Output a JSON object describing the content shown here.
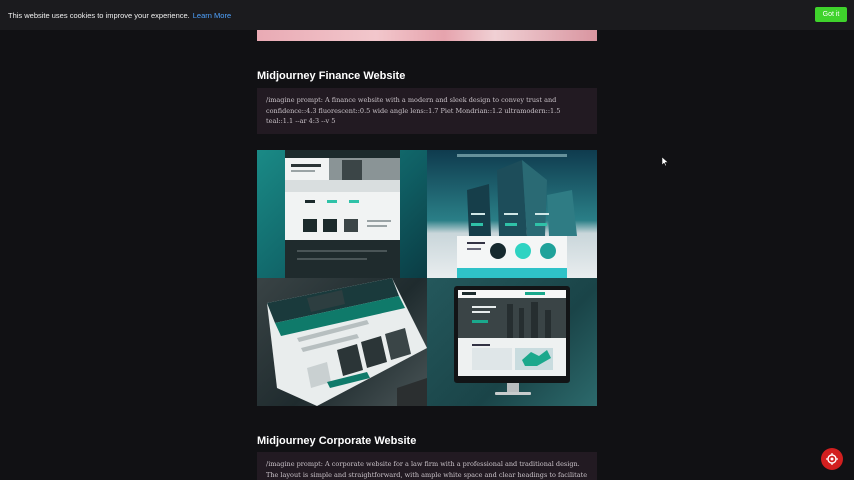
{
  "cookie": {
    "text": "This website uses cookies to improve your experience.",
    "link": "Learn More",
    "button": "Got it"
  },
  "sections": [
    {
      "title": "Midjourney Finance Website",
      "prompt": "/imagine prompt: A finance website with a modern and sleek design to convey trust and confidence::4.3 fluorescent::0.5 wide angle lens::1.7 Piet Mondrian::1.2 ultramodern::1.5 teal::1.1 --ar 4:3 --v 5"
    },
    {
      "title": "Midjourney Corporate Website",
      "prompt": "/imagine prompt: A corporate website for a law firm with a professional and traditional design. The layout is simple and straightforward, with ample white space and clear headings to facilitate easy"
    }
  ],
  "images": [
    {
      "name": "finance-mockup-1"
    },
    {
      "name": "finance-mockup-2"
    },
    {
      "name": "finance-mockup-3"
    },
    {
      "name": "finance-mockup-4"
    }
  ],
  "colors": {
    "background": "#111114",
    "accent_green": "#3fd32c",
    "link_blue": "#4fa3ff",
    "fab_red": "#d21f1f",
    "teal": "#1a8a86"
  },
  "icons": {
    "fab": "scroll-top-icon",
    "cursor": "mouse-cursor-icon"
  }
}
